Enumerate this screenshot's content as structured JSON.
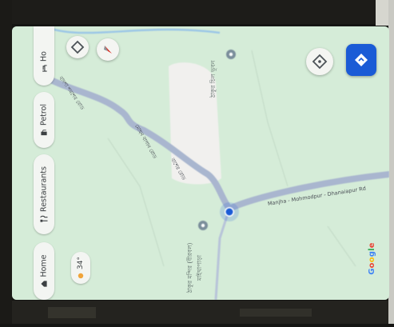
{
  "chips": {
    "home": "Home",
    "restaurants": "Restaurants",
    "petrol": "Petrol",
    "hotels": "Ho"
  },
  "weather": {
    "temp": "34°"
  },
  "places": {
    "top_place": "ঠাকুর চিল ভুবন",
    "bottom_place_line1": "ঠাকুর মন্দির (বীরবল)",
    "bottom_place_line2": "মাইথাপাড়া"
  },
  "roads": {
    "main_road": "Manjha - Mohmodpur - Dhanaiapur Rd",
    "road_a": "বাদশা শমশের রোড",
    "road_b": "মোহন বাগান রোড",
    "road_c": "বাশের রোড"
  },
  "branding": {
    "logo_letters": [
      "G",
      "o",
      "o",
      "g",
      "l",
      "e"
    ],
    "logo_colors": [
      "#4285f4",
      "#ea4335",
      "#fbbc05",
      "#4285f4",
      "#34a853",
      "#ea4335"
    ]
  },
  "colors": {
    "map_land": "#d5ecd8",
    "road": "#a9b6cf",
    "location_dot": "#1a5bd6",
    "directions_button": "#1a5bd6"
  },
  "icons": {
    "home": "home-icon",
    "restaurants": "restaurant-icon",
    "petrol": "fuel-pump-icon",
    "hotels": "bed-icon",
    "layers": "layers-icon",
    "compass": "compass-icon",
    "my_location": "crosshair-icon",
    "directions": "directions-icon",
    "place_pin": "place-pin-icon",
    "weather": "sun-icon"
  }
}
